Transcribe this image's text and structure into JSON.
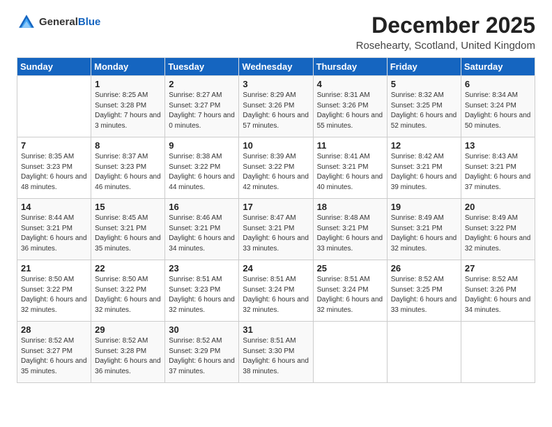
{
  "logo": {
    "general": "General",
    "blue": "Blue"
  },
  "title": "December 2025",
  "subtitle": "Rosehearty, Scotland, United Kingdom",
  "days_of_week": [
    "Sunday",
    "Monday",
    "Tuesday",
    "Wednesday",
    "Thursday",
    "Friday",
    "Saturday"
  ],
  "weeks": [
    [
      {
        "day": "",
        "detail": ""
      },
      {
        "day": "1",
        "detail": "Sunrise: 8:25 AM\nSunset: 3:28 PM\nDaylight: 7 hours\nand 3 minutes."
      },
      {
        "day": "2",
        "detail": "Sunrise: 8:27 AM\nSunset: 3:27 PM\nDaylight: 7 hours\nand 0 minutes."
      },
      {
        "day": "3",
        "detail": "Sunrise: 8:29 AM\nSunset: 3:26 PM\nDaylight: 6 hours\nand 57 minutes."
      },
      {
        "day": "4",
        "detail": "Sunrise: 8:31 AM\nSunset: 3:26 PM\nDaylight: 6 hours\nand 55 minutes."
      },
      {
        "day": "5",
        "detail": "Sunrise: 8:32 AM\nSunset: 3:25 PM\nDaylight: 6 hours\nand 52 minutes."
      },
      {
        "day": "6",
        "detail": "Sunrise: 8:34 AM\nSunset: 3:24 PM\nDaylight: 6 hours\nand 50 minutes."
      }
    ],
    [
      {
        "day": "7",
        "detail": "Sunrise: 8:35 AM\nSunset: 3:23 PM\nDaylight: 6 hours\nand 48 minutes."
      },
      {
        "day": "8",
        "detail": "Sunrise: 8:37 AM\nSunset: 3:23 PM\nDaylight: 6 hours\nand 46 minutes."
      },
      {
        "day": "9",
        "detail": "Sunrise: 8:38 AM\nSunset: 3:22 PM\nDaylight: 6 hours\nand 44 minutes."
      },
      {
        "day": "10",
        "detail": "Sunrise: 8:39 AM\nSunset: 3:22 PM\nDaylight: 6 hours\nand 42 minutes."
      },
      {
        "day": "11",
        "detail": "Sunrise: 8:41 AM\nSunset: 3:21 PM\nDaylight: 6 hours\nand 40 minutes."
      },
      {
        "day": "12",
        "detail": "Sunrise: 8:42 AM\nSunset: 3:21 PM\nDaylight: 6 hours\nand 39 minutes."
      },
      {
        "day": "13",
        "detail": "Sunrise: 8:43 AM\nSunset: 3:21 PM\nDaylight: 6 hours\nand 37 minutes."
      }
    ],
    [
      {
        "day": "14",
        "detail": "Sunrise: 8:44 AM\nSunset: 3:21 PM\nDaylight: 6 hours\nand 36 minutes."
      },
      {
        "day": "15",
        "detail": "Sunrise: 8:45 AM\nSunset: 3:21 PM\nDaylight: 6 hours\nand 35 minutes."
      },
      {
        "day": "16",
        "detail": "Sunrise: 8:46 AM\nSunset: 3:21 PM\nDaylight: 6 hours\nand 34 minutes."
      },
      {
        "day": "17",
        "detail": "Sunrise: 8:47 AM\nSunset: 3:21 PM\nDaylight: 6 hours\nand 33 minutes."
      },
      {
        "day": "18",
        "detail": "Sunrise: 8:48 AM\nSunset: 3:21 PM\nDaylight: 6 hours\nand 33 minutes."
      },
      {
        "day": "19",
        "detail": "Sunrise: 8:49 AM\nSunset: 3:21 PM\nDaylight: 6 hours\nand 32 minutes."
      },
      {
        "day": "20",
        "detail": "Sunrise: 8:49 AM\nSunset: 3:22 PM\nDaylight: 6 hours\nand 32 minutes."
      }
    ],
    [
      {
        "day": "21",
        "detail": "Sunrise: 8:50 AM\nSunset: 3:22 PM\nDaylight: 6 hours\nand 32 minutes."
      },
      {
        "day": "22",
        "detail": "Sunrise: 8:50 AM\nSunset: 3:22 PM\nDaylight: 6 hours\nand 32 minutes."
      },
      {
        "day": "23",
        "detail": "Sunrise: 8:51 AM\nSunset: 3:23 PM\nDaylight: 6 hours\nand 32 minutes."
      },
      {
        "day": "24",
        "detail": "Sunrise: 8:51 AM\nSunset: 3:24 PM\nDaylight: 6 hours\nand 32 minutes."
      },
      {
        "day": "25",
        "detail": "Sunrise: 8:51 AM\nSunset: 3:24 PM\nDaylight: 6 hours\nand 32 minutes."
      },
      {
        "day": "26",
        "detail": "Sunrise: 8:52 AM\nSunset: 3:25 PM\nDaylight: 6 hours\nand 33 minutes."
      },
      {
        "day": "27",
        "detail": "Sunrise: 8:52 AM\nSunset: 3:26 PM\nDaylight: 6 hours\nand 34 minutes."
      }
    ],
    [
      {
        "day": "28",
        "detail": "Sunrise: 8:52 AM\nSunset: 3:27 PM\nDaylight: 6 hours\nand 35 minutes."
      },
      {
        "day": "29",
        "detail": "Sunrise: 8:52 AM\nSunset: 3:28 PM\nDaylight: 6 hours\nand 36 minutes."
      },
      {
        "day": "30",
        "detail": "Sunrise: 8:52 AM\nSunset: 3:29 PM\nDaylight: 6 hours\nand 37 minutes."
      },
      {
        "day": "31",
        "detail": "Sunrise: 8:51 AM\nSunset: 3:30 PM\nDaylight: 6 hours\nand 38 minutes."
      },
      {
        "day": "",
        "detail": ""
      },
      {
        "day": "",
        "detail": ""
      },
      {
        "day": "",
        "detail": ""
      }
    ]
  ]
}
